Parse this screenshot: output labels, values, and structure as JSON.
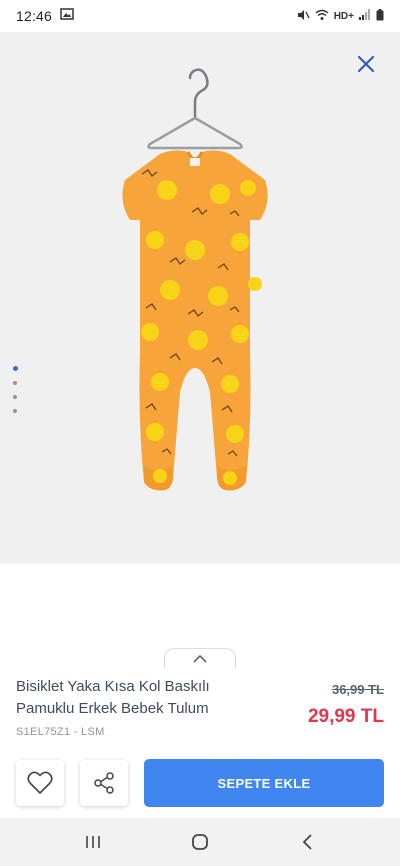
{
  "status_bar": {
    "time": "12:46",
    "network_label": "HD+"
  },
  "product": {
    "title": "Bisiklet Yaka Kısa Kol Baskılı Pamuklu Erkek Bebek Tulum",
    "sku": "S1EL75Z1 - LSM",
    "old_price": "36,99 TL",
    "new_price": "29,99 TL",
    "image_alt": "Orange baby romper with lion print"
  },
  "gallery": {
    "dot_count": 4,
    "active_dot": 1
  },
  "actions": {
    "add_to_cart_label": "SEPETE EKLE"
  },
  "colors": {
    "accent": "#3f86f0",
    "sale_price": "#e2364c",
    "romper": "#f7a53a",
    "lion": "#f7d417"
  }
}
